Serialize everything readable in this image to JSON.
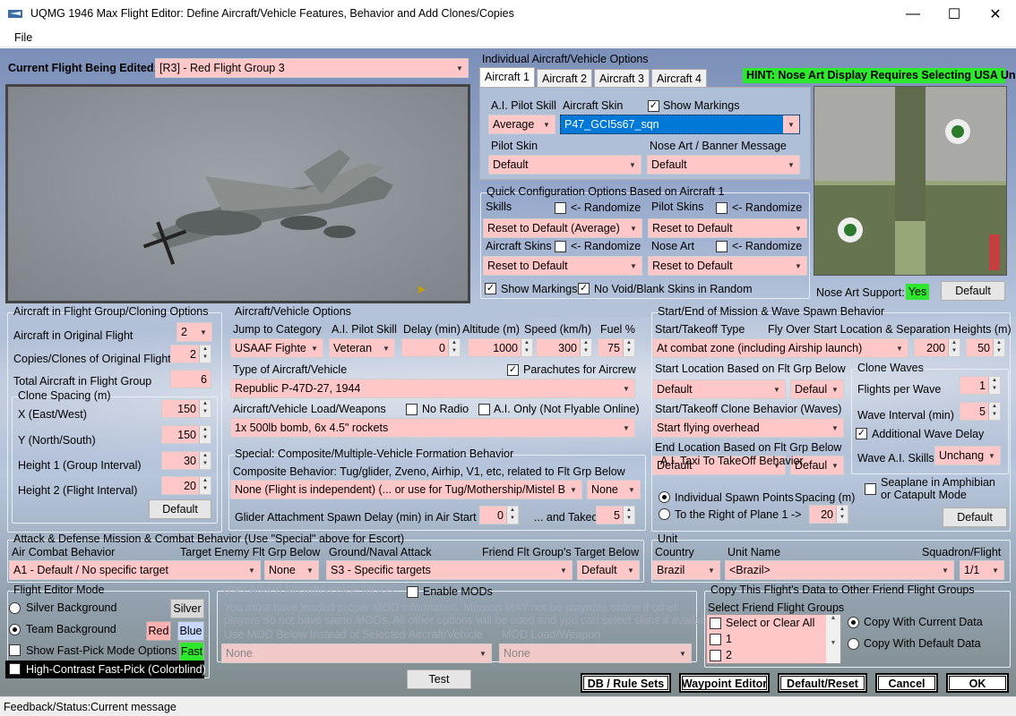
{
  "window": {
    "title": "UQMG 1946 Max Flight Editor:  Define Aircraft/Vehicle Features, Behavior and Add Clones/Copies",
    "minimize": "—",
    "maximize": "☐",
    "close": "✕"
  },
  "menu": {
    "file": "File"
  },
  "current_flight": {
    "label": "Current Flight Being Edited:",
    "value": "[R3] -  Red Flight Group  3"
  },
  "individual": {
    "title": "Individual Aircraft/Vehicle Options",
    "tabs": [
      "Aircraft 1",
      "Aircraft 2",
      "Aircraft 3",
      "Aircraft 4"
    ],
    "hint": "HINT:  Nose Art Display Requires Selecting USA Unit",
    "ai_pilot_skill_label": "A.I. Pilot Skill",
    "ai_pilot_skill": "Average",
    "aircraft_skin_label": "Aircraft Skin",
    "aircraft_skin": "P47_GCI5s67_sqn",
    "show_markings": "Show Markings",
    "pilot_skin_label": "Pilot Skin",
    "pilot_skin": "Default",
    "nose_art_label": "Nose Art / Banner Message",
    "nose_art": "Default"
  },
  "quick": {
    "title": "Quick Configuration Options Based on Aircraft 1",
    "skills": "Skills",
    "randomize": "<- Randomize",
    "pilot_skins": "Pilot Skins",
    "skills_value": "Reset to Default (Average)",
    "pilot_skins_value": "Reset to Default",
    "aircraft_skins": "Aircraft Skins",
    "nose_art": "Nose Art",
    "aircraft_skins_value": "Reset to Default",
    "nose_art_value": "Reset to Default",
    "show_markings": "Show Markings",
    "no_void": "No Void/Blank Skins in Random"
  },
  "nose_support": {
    "label": "Nose Art Support:",
    "value": "Yes",
    "default_btn": "Default"
  },
  "cloning": {
    "title": "Aircraft in Flight Group/Cloning Options",
    "original_label": "Aircraft in Original Flight",
    "original": "2",
    "copies_label": "Copies/Clones of Original Flight",
    "copies": "2",
    "total_label": "Total Aircraft in Flight Group",
    "total": "6",
    "spacing_title": "Clone Spacing (m)",
    "x_label": "X (East/West)",
    "x": "150",
    "y_label": "Y (North/South)",
    "y": "150",
    "h1_label": "Height 1 (Group Interval)",
    "h1": "30",
    "h2_label": "Height 2 (Flight Interval)",
    "h2": "20",
    "default_btn": "Default"
  },
  "vehicle": {
    "title": "Aircraft/Vehicle Options",
    "jump_label": "Jump to Category",
    "jump": "USAAF Fighter",
    "skill_label": "A.I. Pilot Skill",
    "skill": "Veteran",
    "delay_label": "Delay (min)",
    "delay": "0",
    "alt_label": "Altitude (m)",
    "alt": "1000",
    "speed_label": "Speed (km/h)",
    "speed": "300",
    "fuel_label": "Fuel %",
    "fuel": "75",
    "type_label": "Type of Aircraft/Vehicle",
    "parachutes": "Parachutes for Aircrew",
    "type": "Republic P-47D-27, 1944",
    "load_label": "Aircraft/Vehicle Load/Weapons",
    "no_radio": "No Radio",
    "ai_only": "A.I. Only (Not Flyable Online)",
    "load": "1x 500lb bomb, 6x 4.5\" rockets"
  },
  "special": {
    "title": "Special: Composite/Multiple-Vehicle Formation Behavior",
    "comp_label": "Composite Behavior: Tug/glider, Zveno, Airhip, V1, etc, related to Flt Grp Below",
    "comp": "None (Flight is independent) (... or use for Tug/Mothership/Mistel Bomb)",
    "comp2": "None",
    "glider_label": "Glider Attachment Spawn Delay (min) in Air Start",
    "glider": "0",
    "takeoff_label": "... and Takeoff",
    "takeoff": "5"
  },
  "start": {
    "title": "Start/End of Mission & Wave Spawn Behavior",
    "type_label": "Start/Takeoff Type",
    "type": "At combat zone (including Airship launch)",
    "fly_label": "Fly Over Start Location & Separation Heights (m)",
    "h1": "200",
    "h2": "50",
    "loc_label": "Start Location Based on Flt Grp Below",
    "loc": "Default",
    "loc2": "Default",
    "clone_label": "Start/Takeoff Clone Behavior (Waves)",
    "clone": "Start flying overhead",
    "end_label": "End Location Based on Flt Grp Below",
    "end": "Default",
    "end2": "Default",
    "waves_title": "Clone Waves",
    "fpw_label": "Flights per Wave",
    "fpw": "1",
    "interval_label": "Wave Interval (min)",
    "interval": "5",
    "additional": "Additional Wave Delay",
    "skills_label": "Wave A.I. Skills",
    "skills": "Unchanged",
    "taxi_title": "A.I. Taxi To TakeOff Behavior",
    "individual": "Individual Spawn Points",
    "spacing_label": "Spacing (m)",
    "right": "To the Right of Plane 1 ->",
    "spacing": "20",
    "seaplane": "Seaplane in Amphibian",
    "catapult": "or Catapult Mode",
    "default_btn": "Default"
  },
  "attack": {
    "title": "Attack & Defense Mission & Combat Behavior (Use \"Special\" above for Escort)",
    "air_label": "Air Combat Behavior",
    "air": "A1 - Default / No specific target",
    "enemy_label": "Target Enemy Flt Grp Below",
    "enemy": "None",
    "ground_label": "Ground/Naval Attack",
    "ground": "S3 - Specific targets",
    "friend_label": "Friend Flt Group's Target Below",
    "friend": "Default"
  },
  "unit": {
    "title": "Unit",
    "country_label": "Country",
    "country": "Brazil",
    "name_label": "Unit Name",
    "name": "<Brazil>",
    "squadron_label": "Squadron/Flight",
    "squadron": "1/1"
  },
  "mode": {
    "title": "Flight Editor Mode",
    "silver": "Silver Background",
    "silver_btn": "Silver",
    "team": "Team Background",
    "red_btn": "Red",
    "blue_btn": "Blue",
    "fast": "Show Fast-Pick Mode Options",
    "fast_btn": "Fast",
    "contrast": "High-Contrast Fast-Pick (Colorblind)"
  },
  "mods": {
    "title": "User Added Aircraft/Vehicle MODs",
    "enable": "Enable MODs",
    "line1": "You must have loaded proper MOD information. Mission MAY not be playable online if other",
    "line2": "players do not have same MODs.  All other options will be used and you can select skins if available.",
    "below_label": "Use MOD Below Instead of Selected Aircraft/Vehicle",
    "load_label": "MOD Load/Weapon",
    "mod": "None",
    "mod_load": "None"
  },
  "copy": {
    "title": "Copy This Flight's Data to Other Friend Flight Groups",
    "select_label": "Select Friend Flight Groups",
    "items": [
      "Select or Clear All",
      "1",
      "2"
    ],
    "current": "Copy With Current Data",
    "default": "Copy With Default Data"
  },
  "buttons": {
    "test": "Test",
    "db": "DB / Rule Sets",
    "waypoint": "Waypoint Editor",
    "reset": "Default/Reset",
    "cancel": "Cancel",
    "ok": "OK"
  },
  "status": {
    "label": "Feedback/Status:",
    "message": "Current message"
  }
}
